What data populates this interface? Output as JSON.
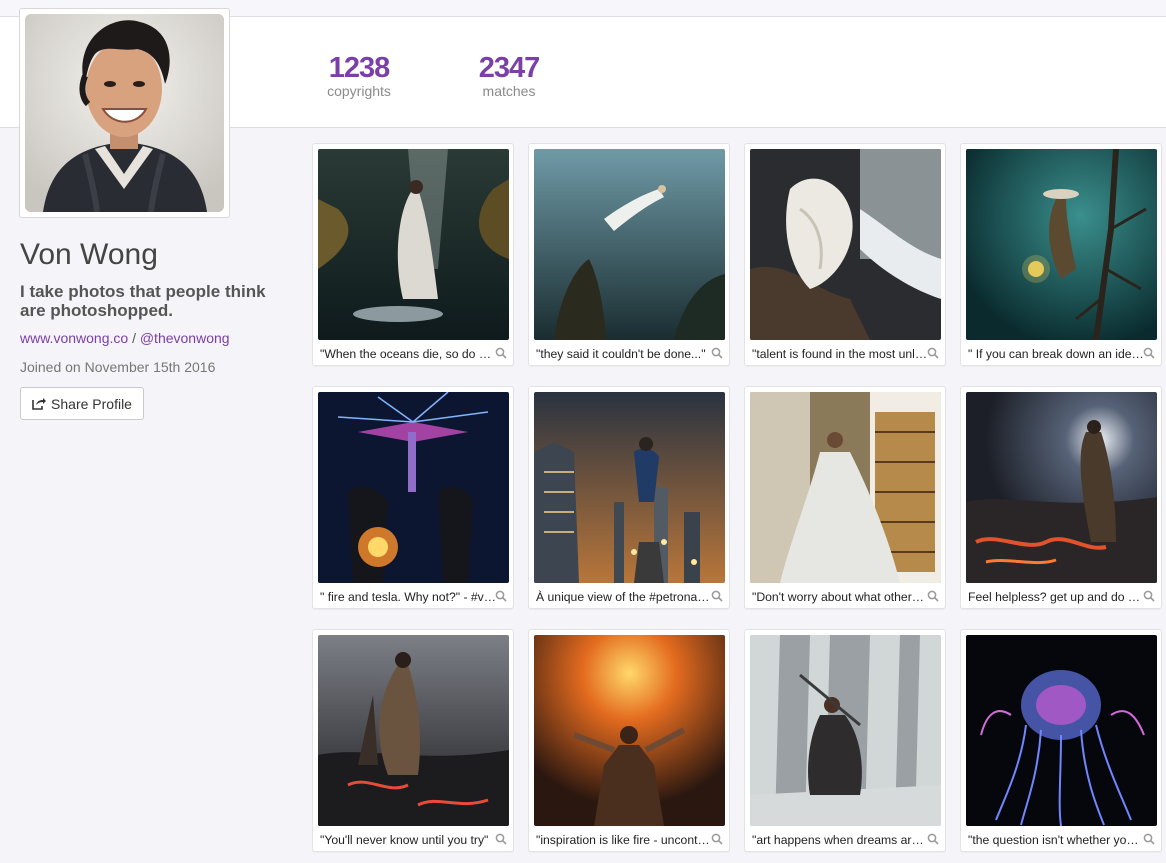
{
  "profile": {
    "name": "Von Wong",
    "bio": "I take photos that people think are photoshopped.",
    "website": "www.vonwong.co",
    "separator": "/",
    "handle": "@thevonwong",
    "joined": "Joined on November 15th 2016",
    "share_label": "Share Profile"
  },
  "stats": {
    "copyrights_count": "1238",
    "copyrights_label": "copyrights",
    "matches_count": "2347",
    "matches_label": "matches"
  },
  "colors": {
    "accent": "#7b3fa8",
    "background": "#f5f4f8"
  },
  "icons": {
    "share": "share-icon",
    "magnifier": "magnifier-icon"
  },
  "photos": [
    {
      "caption": "\"When the oceans die, so do we...\""
    },
    {
      "caption": "\"they said it couldn't be done...\""
    },
    {
      "caption": "\"talent is found in the most unlikely places\""
    },
    {
      "caption": "\" If you can break down an idea...\""
    },
    {
      "caption": "\" fire and tesla. Why not?\" - #vonwong"
    },
    {
      "caption": "À unique view of the #petronas towers"
    },
    {
      "caption": "\"Don't worry about what others think\""
    },
    {
      "caption": "Feel helpless? get up and do something"
    },
    {
      "caption": "\"You'll never know until you try\""
    },
    {
      "caption": "\"inspiration is like fire - uncontrollable\""
    },
    {
      "caption": "\"art happens when dreams are chased\""
    },
    {
      "caption": "\"the question isn't whether you can\""
    }
  ]
}
